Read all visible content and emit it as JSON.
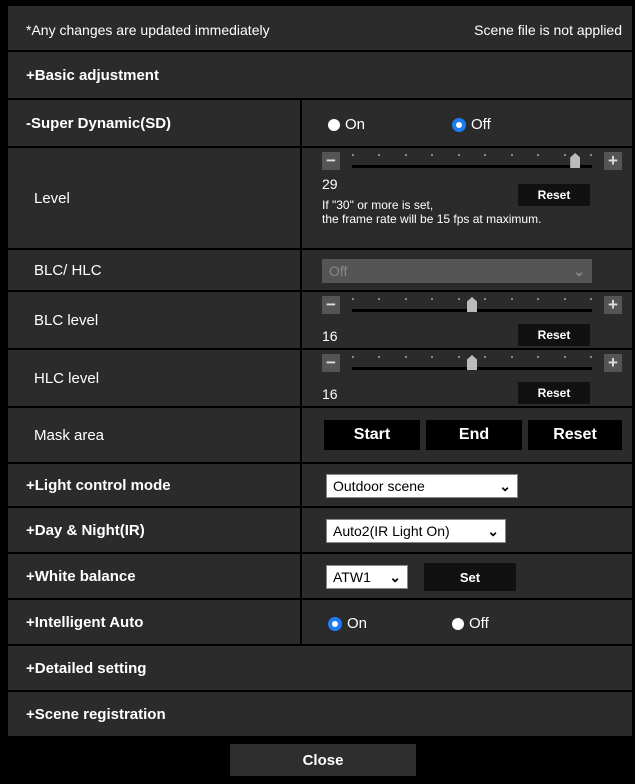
{
  "header": {
    "notice": "*Any changes are updated immediately",
    "status": "Scene file is not applied"
  },
  "basic_adjustment": "+Basic adjustment",
  "super_dynamic": {
    "label": "-Super Dynamic(SD)",
    "on_label": "On",
    "off_label": "Off",
    "selected": "Off"
  },
  "level": {
    "label": "Level",
    "value": "29",
    "fraction": 0.93,
    "reset": "Reset",
    "note_line1": "If \"30\" or more is set,",
    "note_line2": "the frame rate will be 15 fps at maximum."
  },
  "blc_hlc": {
    "label": "BLC/ HLC",
    "value": "Off"
  },
  "blc_level": {
    "label": "BLC level",
    "value": "16",
    "fraction": 0.5,
    "reset": "Reset"
  },
  "hlc_level": {
    "label": "HLC level",
    "value": "16",
    "fraction": 0.5,
    "reset": "Reset"
  },
  "mask_area": {
    "label": "Mask area",
    "start": "Start",
    "end": "End",
    "reset": "Reset"
  },
  "light_control": {
    "label": "+Light control mode",
    "value": "Outdoor scene"
  },
  "day_night": {
    "label": "+Day & Night(IR)",
    "value": "Auto2(IR Light On)"
  },
  "white_balance": {
    "label": "+White balance",
    "value": "ATW1",
    "set": "Set"
  },
  "intelligent_auto": {
    "label": "+Intelligent Auto",
    "on_label": "On",
    "off_label": "Off",
    "selected": "On"
  },
  "detailed_setting": "+Detailed setting",
  "scene_registration": "+Scene registration",
  "close": "Close",
  "colors": {
    "panel": "#2b2b2b",
    "radio_accent": "#1e7cf2"
  },
  "icons": {
    "minus": "minus-icon",
    "plus": "plus-icon",
    "chevron": "chevron-down-icon"
  }
}
